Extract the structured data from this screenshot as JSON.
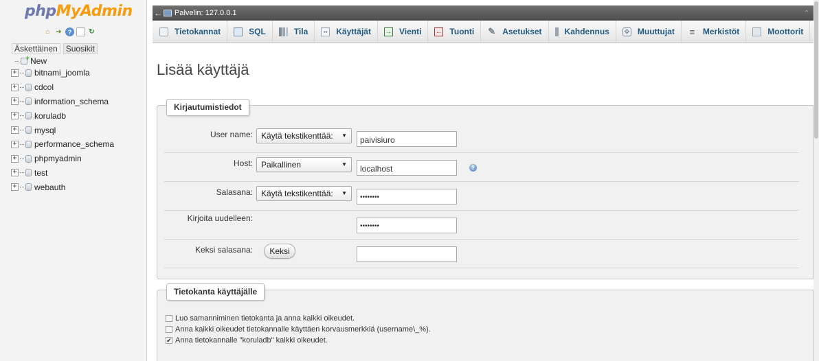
{
  "app": {
    "logo": {
      "php": "php",
      "my": "My",
      "admin": "Admin"
    },
    "logo_icons": [
      "home-icon",
      "exit-icon",
      "help-icon",
      "docs-icon",
      "reload-icon"
    ]
  },
  "left_panel": {
    "tabs": [
      "Äskettäinen",
      "Suosikit"
    ],
    "new_label": "New",
    "databases": [
      "bitnami_joomla",
      "cdcol",
      "information_schema",
      "koruladb",
      "mysql",
      "performance_schema",
      "phpmyadmin",
      "test",
      "webauth"
    ]
  },
  "server_bar": {
    "label": "Palvelin: 127.0.0.1"
  },
  "menu": {
    "tabs": [
      "Tietokannat",
      "SQL",
      "Tila",
      "Käyttäjät",
      "Vienti",
      "Tuonti",
      "Asetukset",
      "Kahdennus",
      "Muuttujat",
      "Merkistöt",
      "Moottorit"
    ]
  },
  "page": {
    "title": "Lisää käyttäjä"
  },
  "login_info": {
    "legend": "Kirjautumistiedot",
    "user_name": {
      "label": "User name:",
      "select": "Käytä tekstikenttää:",
      "value": "paivisiuro"
    },
    "host": {
      "label": "Host:",
      "select": "Paikallinen",
      "value": "localhost"
    },
    "password": {
      "label": "Salasana:",
      "select": "Käytä tekstikenttää:",
      "value": "••••••••"
    },
    "retype": {
      "label": "Kirjoita uudelleen:",
      "value": "••••••••"
    },
    "generate": {
      "label": "Keksi salasana:",
      "button": "Keksi",
      "value": ""
    }
  },
  "db_for_user": {
    "legend": "Tietokanta käyttäjälle",
    "options": [
      {
        "label": "Luo samanniminen tietokanta ja anna kaikki oikeudet.",
        "checked": false
      },
      {
        "label": "Anna kaikki oikeudet tietokannalle käyttäen korvausmerkkiä (username\\_%).",
        "checked": false
      },
      {
        "label": "Anna tietokannalle \"koruladb\" kaikki oikeudet.",
        "checked": true
      }
    ]
  }
}
